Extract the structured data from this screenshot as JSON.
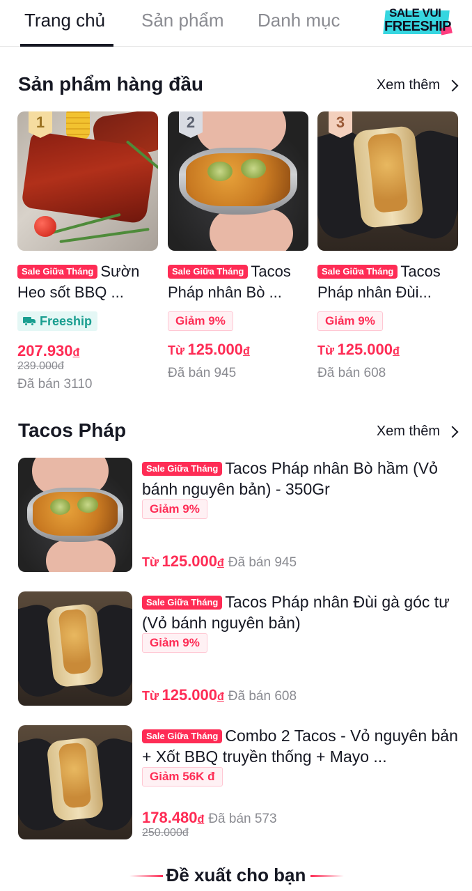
{
  "tabs": [
    {
      "label": "Trang chủ",
      "active": true
    },
    {
      "label": "Sản phẩm",
      "active": false
    },
    {
      "label": "Danh mục",
      "active": false
    }
  ],
  "promo_badge": {
    "line1": "SALE VUI",
    "line2": "FREESHIP"
  },
  "sections": {
    "top": {
      "title": "Sản phẩm hàng đầu",
      "see_more": "Xem thêm",
      "items": [
        {
          "rank": "1",
          "tag": "Sale Giữa Tháng",
          "name": "Sườn Heo sốt BBQ ...",
          "badge": "Freeship",
          "price_prefix": "",
          "price": "207.930",
          "currency": "đ",
          "old_price": "239.000đ",
          "sold": "Đã bán 3110"
        },
        {
          "rank": "2",
          "tag": "Sale Giữa Tháng",
          "name": "Tacos Pháp nhân Bò ...",
          "badge": "Giảm 9%",
          "price_prefix": "Từ",
          "price": "125.000",
          "currency": "đ",
          "old_price": "",
          "sold": "Đã bán 945"
        },
        {
          "rank": "3",
          "tag": "Sale Giữa Tháng",
          "name": "Tacos Pháp nhân Đùi...",
          "badge": "Giảm 9%",
          "price_prefix": "Từ",
          "price": "125.000",
          "currency": "đ",
          "old_price": "",
          "sold": "Đã bán 608"
        }
      ]
    },
    "tacos": {
      "title": "Tacos Pháp",
      "see_more": "Xem thêm",
      "items": [
        {
          "tag": "Sale Giữa Tháng",
          "name": "Tacos Pháp nhân Bò hầm (Vỏ bánh nguyên bản) - 350Gr",
          "badge": "Giảm 9%",
          "price_prefix": "Từ",
          "price": "125.000",
          "currency": "đ",
          "old_price": "",
          "sold": "Đã bán 945"
        },
        {
          "tag": "Sale Giữa Tháng",
          "name": "Tacos Pháp nhân Đùi gà góc tư (Vỏ bánh nguyên bản)",
          "badge": "Giảm 9%",
          "price_prefix": "Từ",
          "price": "125.000",
          "currency": "đ",
          "old_price": "",
          "sold": "Đã bán 608"
        },
        {
          "tag": "Sale Giữa Tháng",
          "name": "Combo 2 Tacos - Vỏ nguyên bản + Xốt BBQ truyền thống + Mayo ...",
          "badge": "Giảm 56K đ",
          "price_prefix": "",
          "price": "178.480",
          "currency": "đ",
          "old_price": "250.000đ",
          "sold": "Đã bán 573"
        }
      ]
    }
  },
  "recommend": {
    "title": "Đề xuất cho bạn"
  },
  "colors": {
    "accent": "#fe2c55",
    "freeship": "#1a9e90",
    "text": "#161823",
    "muted": "#8a8b91"
  },
  "icons": {
    "see_more": "chevron-right-icon",
    "freeship": "truck-icon"
  }
}
